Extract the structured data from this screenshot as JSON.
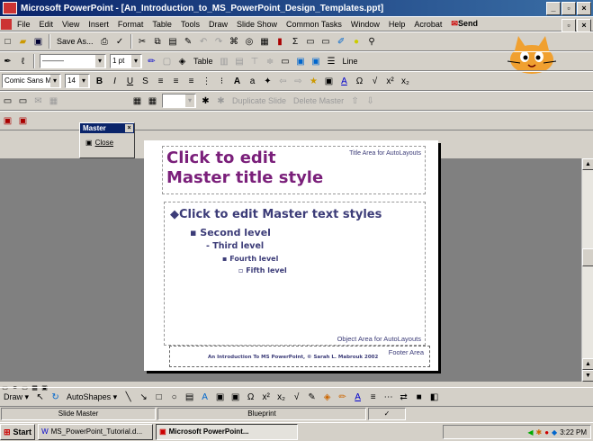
{
  "window": {
    "title": "Microsoft PowerPoint - [An_Introduction_to_MS_PowerPoint_Design_Templates.ppt]"
  },
  "menu": [
    "File",
    "Edit",
    "View",
    "Insert",
    "Format",
    "Table",
    "Tools",
    "Draw",
    "Slide Show",
    "Common Tasks",
    "Window",
    "Help",
    "Acrobat"
  ],
  "send_label": "Send",
  "toolbar": {
    "save_as_label": "Save As...",
    "line_width": "1 pt",
    "table_label": "Table",
    "line_label": "Line"
  },
  "format": {
    "font": "Comic Sans MS",
    "size": "14"
  },
  "master_toolbar": {
    "title": "Master",
    "close_label": "Close",
    "dup_label": "Duplicate Slide",
    "del_label": "Delete Master"
  },
  "slide": {
    "title": "Click to edit Master title style",
    "title_area_label": "Title Area for AutoLayouts",
    "level1": "Click to edit Master text styles",
    "level2": "Second level",
    "level3": "Third level",
    "level4": "Fourth level",
    "level5": "Fifth level",
    "object_area_label": "Object Area for AutoLayouts",
    "footer_area_label": "Footer Area",
    "footer_text": "An Introduction To MS PowerPoint, © Sarah L. Mabrouk 2002"
  },
  "draw_toolbar": {
    "draw_label": "Draw",
    "autoshapes_label": "AutoShapes"
  },
  "status": {
    "view": "Slide Master",
    "template": "Blueprint"
  },
  "taskbar": {
    "start_label": "Start",
    "task1": "MS_PowerPoint_Tutorial.d...",
    "task2": "Microsoft PowerPoint...",
    "time": "3:22 PM"
  }
}
